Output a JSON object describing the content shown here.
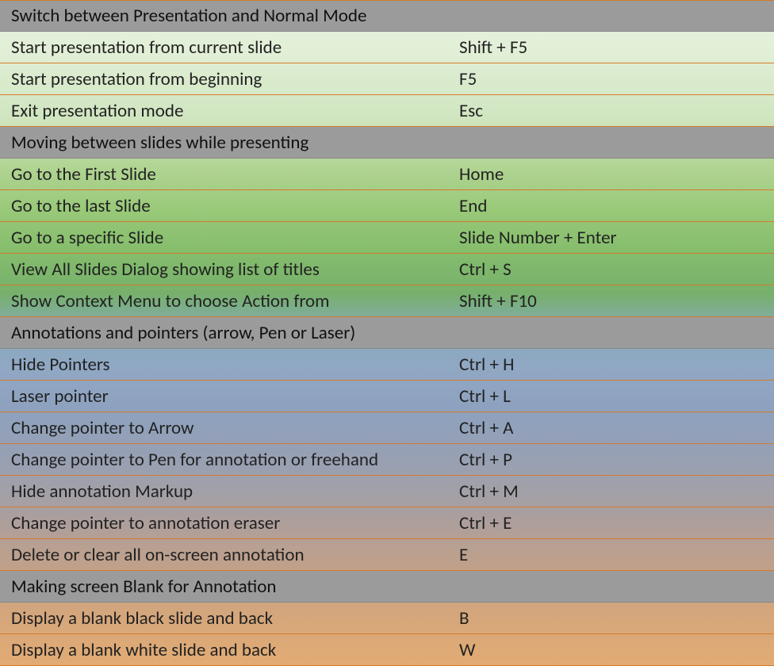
{
  "sections": [
    {
      "title": "Switch between Presentation and Normal Mode",
      "rows": [
        {
          "desc": "Start presentation from current slide",
          "shortcut": "Shift + F5"
        },
        {
          "desc": "Start presentation from beginning",
          "shortcut": "F5"
        },
        {
          "desc": "Exit presentation mode",
          "shortcut": "Esc"
        }
      ]
    },
    {
      "title": "Moving between slides while presenting",
      "rows": [
        {
          "desc": "Go to the First Slide",
          "shortcut": "Home"
        },
        {
          "desc": "Go to the last Slide",
          "shortcut": "End"
        },
        {
          "desc": "Go to a specific Slide",
          "shortcut": "Slide Number + Enter"
        },
        {
          "desc": "View All Slides Dialog showing list of titles",
          "shortcut": "Ctrl + S"
        },
        {
          "desc": "Show Context Menu to choose Action from",
          "shortcut": "Shift + F10"
        }
      ]
    },
    {
      "title": "Annotations and pointers (arrow, Pen or Laser)",
      "rows": [
        {
          "desc": "Hide Pointers",
          "shortcut": "Ctrl + H"
        },
        {
          "desc": "Laser pointer",
          "shortcut": "Ctrl + L"
        },
        {
          "desc": "Change pointer to Arrow",
          "shortcut": "Ctrl + A"
        },
        {
          "desc": "Change pointer to Pen for annotation or freehand",
          "shortcut": "Ctrl +  P"
        },
        {
          "desc": "Hide annotation Markup",
          "shortcut": "Ctrl + M"
        },
        {
          "desc": "Change pointer to annotation eraser",
          "shortcut": "Ctrl + E"
        },
        {
          "desc": "Delete or clear all on-screen annotation",
          "shortcut": "E"
        }
      ]
    },
    {
      "title": "Making screen Blank for Annotation",
      "rows": [
        {
          "desc": "Display a blank black slide and back",
          "shortcut": "B"
        },
        {
          "desc": "Display a blank white slide and back",
          "shortcut": "W"
        }
      ]
    }
  ]
}
